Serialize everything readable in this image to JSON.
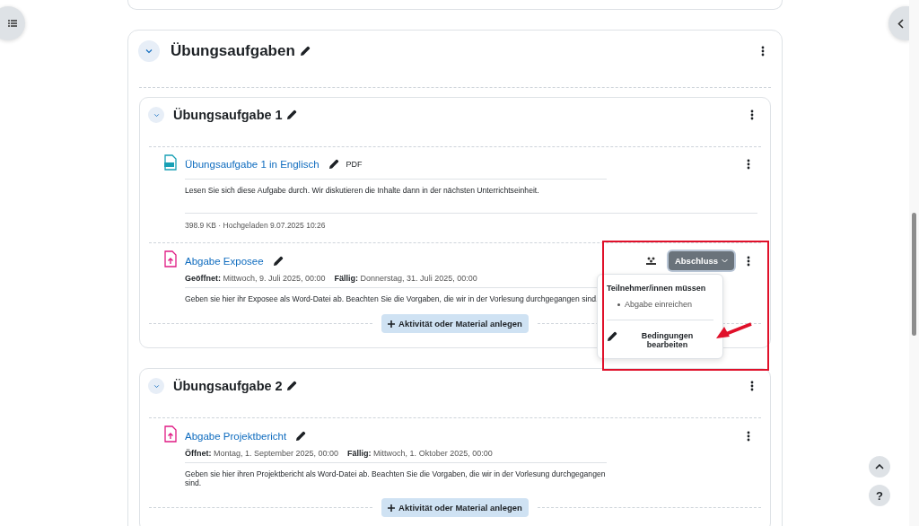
{
  "section": {
    "title": "Übungsaufgaben",
    "expanded": true,
    "subsections": [
      {
        "title": "Übungsaufgabe 1",
        "expanded": true,
        "activities": [
          {
            "kind": "pdf",
            "name": "Übungsaufgabe 1 in Englisch",
            "type_label": "PDF",
            "description": "Lesen Sie sich diese Aufgabe durch. Wir diskutieren die Inhalte dann in der nächsten Unterrichtseinheit.",
            "file_info": "398.9 KB · Hochgeladen 9.07.2025 10:26"
          },
          {
            "kind": "assignment",
            "name": "Abgabe Exposee",
            "dates": [
              "**Geöffnet:** Mittwoch, 9. Juli 2025, 00:00",
              "**Fällig:** Donnerstag, 31. Juli 2025, 00:00"
            ],
            "description": "Geben sie hier ihr Exposee als Word-Datei ab. Beachten Sie die Vorgaben, die wir in der Vorlesung durchgegangen sind.",
            "completion": {
              "button": "Abschluss",
              "expanded": true,
              "heading": "Teilnehmer/innen müssen",
              "conditions": [
                "Abgabe einreichen"
              ],
              "edit_link": "Bedingungen bearbeiten"
            }
          }
        ],
        "add_button": "Aktivität oder Material anlegen"
      },
      {
        "title": "Übungsaufgabe 2",
        "expanded": true,
        "activities": [
          {
            "kind": "assignment",
            "name": "Abgabe Projektbericht",
            "dates": [
              "**Öffnet:** Montag, 1. September 2025, 00:00",
              "**Fällig:** Mittwoch, 1. Oktober 2025, 00:00"
            ],
            "description": "Geben sie hier ihren Projektbericht als Word-Datei ab. Beachten Sie die Vorgaben, die wir in der Vorlesung durchgegangen sind."
          }
        ],
        "add_button": "Aktivität oder Material anlegen"
      }
    ]
  },
  "help_button": "?"
}
